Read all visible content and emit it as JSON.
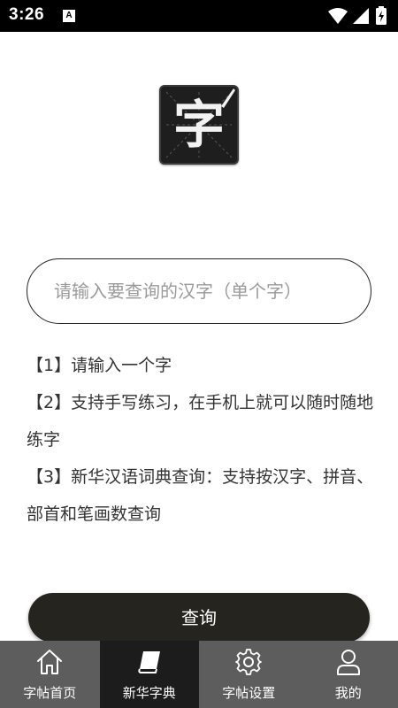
{
  "status_bar": {
    "time": "3:26",
    "notification_icon_letter": "A",
    "icons": [
      "wifi-icon",
      "cell-signal-icon",
      "battery-charging-icon"
    ]
  },
  "logo": {
    "character": "字",
    "icon": "calligraphy-brush-icon"
  },
  "search": {
    "placeholder": "请输入要查询的汉字（单个字）",
    "value": ""
  },
  "tips": [
    "【1】请输入一个字",
    "【2】支持手写练习，在手机上就可以随时随地练字",
    "【3】新华汉语词典查询：支持按汉字、拼音、部首和笔画数查询"
  ],
  "query_button": {
    "label": "查询"
  },
  "tab_bar": {
    "tabs": [
      {
        "label": "字帖首页",
        "icon": "home-icon",
        "active": false
      },
      {
        "label": "新华字典",
        "icon": "book-icon",
        "active": true
      },
      {
        "label": "字帖设置",
        "icon": "gear-icon",
        "active": false
      },
      {
        "label": "我的",
        "icon": "user-icon",
        "active": false
      }
    ]
  },
  "colors": {
    "status_bar": "#000000",
    "button": "#26241f",
    "tab_bar": "#5d5d5d",
    "tab_active": "#1c1c1c",
    "placeholder": "#9a9a9a"
  }
}
